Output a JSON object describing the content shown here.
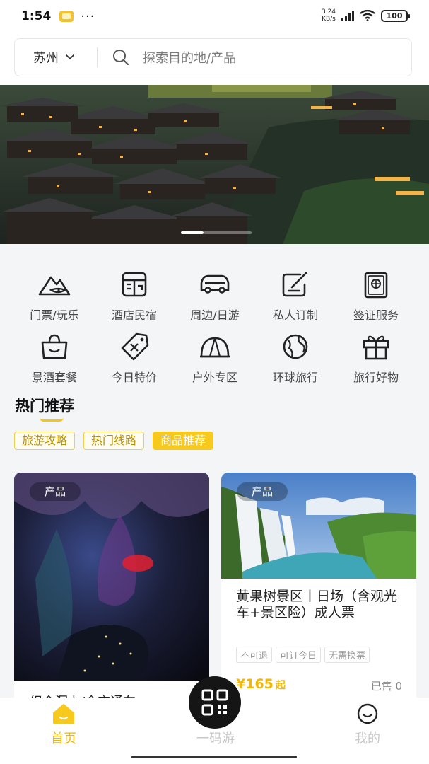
{
  "status_bar": {
    "time": "1:54",
    "dots": "···",
    "speed_value": "3.24",
    "speed_unit": "KB/s",
    "battery": "100"
  },
  "search": {
    "city": "苏州",
    "placeholder": "探索目的地/产品"
  },
  "categories": [
    {
      "label": "门票/玩乐",
      "icon": "mountain-ticket-icon"
    },
    {
      "label": "酒店民宿",
      "icon": "hotel-icon"
    },
    {
      "label": "周边/日游",
      "icon": "car-icon"
    },
    {
      "label": "私人订制",
      "icon": "edit-note-icon"
    },
    {
      "label": "签证服务",
      "icon": "passport-icon"
    },
    {
      "label": "景酒套餐",
      "icon": "shopping-bag-icon"
    },
    {
      "label": "今日特价",
      "icon": "price-tag-icon"
    },
    {
      "label": "户外专区",
      "icon": "tent-icon"
    },
    {
      "label": "环球旅行",
      "icon": "globe-icon"
    },
    {
      "label": "旅行好物",
      "icon": "gift-icon"
    }
  ],
  "hot": {
    "title": "热门推荐",
    "tabs": [
      {
        "label": "旅游攻略",
        "active": false
      },
      {
        "label": "热门线路",
        "active": false
      },
      {
        "label": "商品推荐",
        "active": true
      }
    ]
  },
  "cards": {
    "left": {
      "tag": "产品",
      "title": "织金洞上/含交通车"
    },
    "right": {
      "tag": "产品",
      "title": "黄果树景区丨日场（含观光车+景区险）成人票",
      "chips": [
        "不可退",
        "可订今日",
        "无需换票"
      ],
      "price": "¥165",
      "price_suffix": "起",
      "sold": "已售 0"
    }
  },
  "nav": {
    "home": "首页",
    "qr": "一码游",
    "mine": "我的"
  },
  "colors": {
    "accent": "#f8c91d",
    "price": "#f5b800"
  }
}
